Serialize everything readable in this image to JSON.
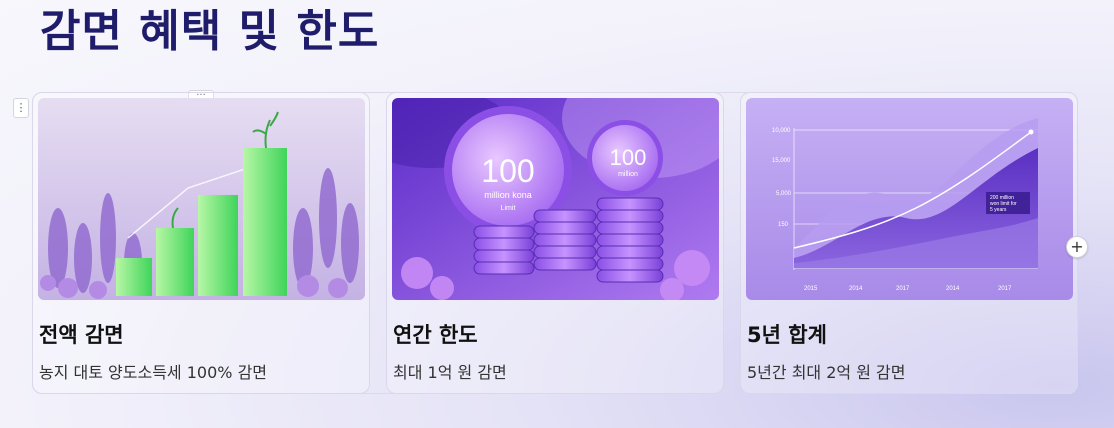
{
  "page": {
    "title": "감면 혜택 및 한도"
  },
  "controls": {
    "handle_glyph": "⋮",
    "more_glyph": "···",
    "add_glyph": "+"
  },
  "cards": [
    {
      "title": "전액 감면",
      "desc": "농지 대토 양도소득세 100% 감면",
      "image": "growth-bars-lavender"
    },
    {
      "title": "연간 한도",
      "desc": "최대 1억 원 감면",
      "image": "coin-stacks-100"
    },
    {
      "title": "5년 합계",
      "desc": "5년간 최대 2억 원 감면",
      "image": "area-chart"
    }
  ],
  "coin_image": {
    "coin_big_value": "100",
    "coin_big_sub": "million kona",
    "coin_big_sub2": "Limit",
    "coin_small_value": "100",
    "coin_small_sub": "million"
  },
  "chart_image": {
    "y_ticks": [
      "10,000",
      "15,000",
      "5,000",
      "150"
    ],
    "x_ticks": [
      "2015",
      "2014",
      "2017",
      "2014",
      "2017"
    ],
    "annotation": [
      "200 million",
      "won limit for",
      "5 years"
    ]
  },
  "colors": {
    "title": "#1f1d6b",
    "accent_purple": "#7b4ee0",
    "green": "#3fd45a"
  }
}
